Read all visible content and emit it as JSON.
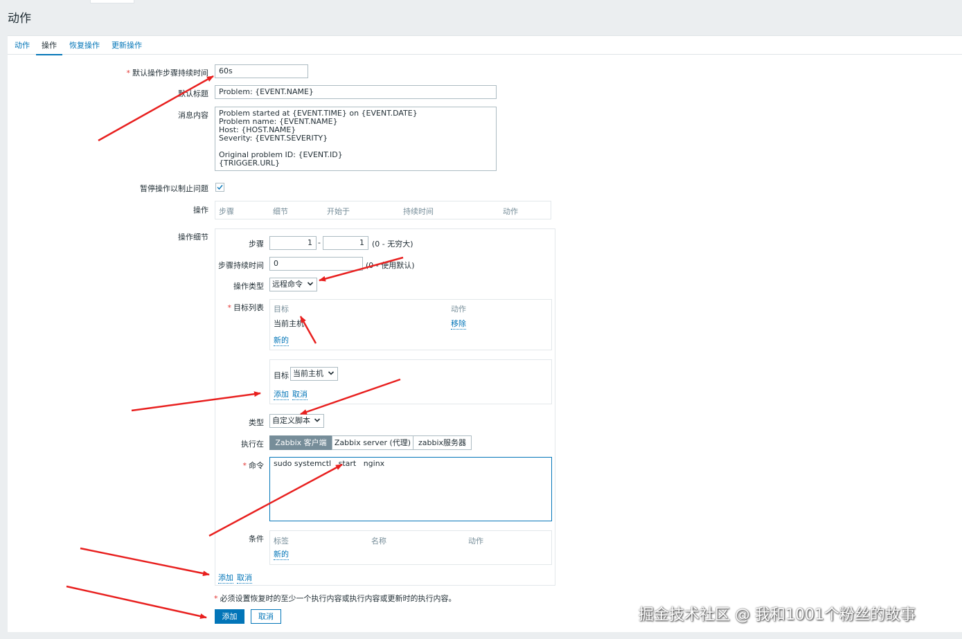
{
  "page": {
    "title": "动作"
  },
  "tabs": [
    {
      "label": "动作"
    },
    {
      "label": "操作"
    },
    {
      "label": "恢复操作"
    },
    {
      "label": "更新操作"
    }
  ],
  "form": {
    "step_duration": {
      "label": "默认操作步骤持续时间",
      "value": "60s"
    },
    "subject": {
      "label": "默认标题",
      "value": "Problem: {EVENT.NAME}"
    },
    "message": {
      "label": "消息内容",
      "value": "Problem started at {EVENT.TIME} on {EVENT.DATE}\nProblem name: {EVENT.NAME}\nHost: {HOST.NAME}\nSeverity: {EVENT.SEVERITY}\n\nOriginal problem ID: {EVENT.ID}\n{TRIGGER.URL}"
    },
    "pause": {
      "label": "暂停操作以制止问题",
      "checked": true
    },
    "operations": {
      "label": "操作",
      "columns": [
        "步骤",
        "细节",
        "开始于",
        "持续时间",
        "动作"
      ]
    },
    "details": {
      "label": "操作细节",
      "steps": {
        "label": "步骤",
        "from": "1",
        "sep": "-",
        "to": "1",
        "hint": "(0 - 无穷大)"
      },
      "step_duration": {
        "label": "步骤持续时间",
        "value": "0",
        "hint": "(0 - 使用默认)"
      },
      "op_type": {
        "label": "操作类型",
        "value": "远程命令"
      },
      "target_list": {
        "label": "目标列表",
        "col_target": "目标",
        "col_action": "动作",
        "row_target": "当前主机",
        "row_action": "移除",
        "new_link": "新的"
      },
      "target_editor": {
        "label": "目标",
        "value": "当前主机",
        "add": "添加",
        "cancel": "取消"
      },
      "type": {
        "label": "类型",
        "value": "自定义脚本"
      },
      "exec_on": {
        "label": "执行在",
        "options": [
          "Zabbix 客户端",
          "Zabbix server (代理)",
          "zabbix服务器"
        ],
        "selected": "Zabbix 客户端"
      },
      "command": {
        "label": "命令",
        "value": "sudo systemctl   start   nginx"
      },
      "conditions": {
        "label": "条件",
        "columns": [
          "标签",
          "名称",
          "动作"
        ],
        "new_link": "新的"
      },
      "add": "添加",
      "cancel": "取消"
    },
    "required_note": "必须设置恢复时的至少一个执行内容或执行内容或更新时的执行内容。",
    "buttons": {
      "add": "添加",
      "cancel": "取消"
    }
  },
  "watermark": "掘金技术社区 @ 我和1001个粉丝的故事",
  "colors": {
    "accent": "#0275b8",
    "arrow": "#e8201f",
    "required": "#e33734",
    "segment_selected": "#768d99"
  }
}
